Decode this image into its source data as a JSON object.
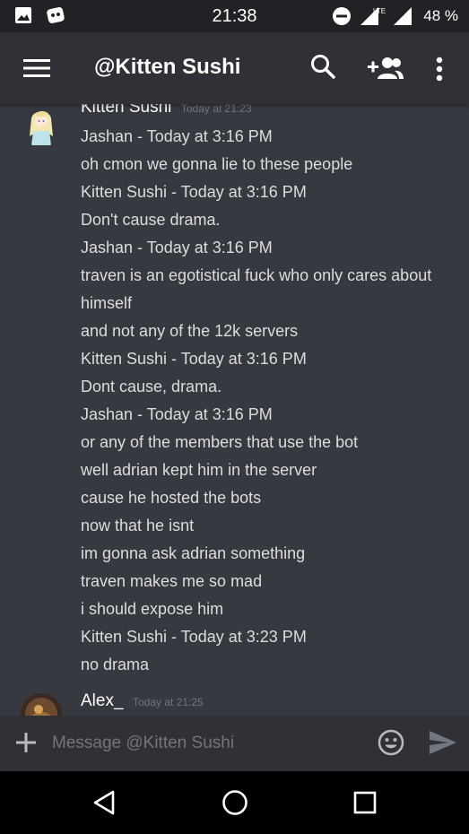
{
  "status_bar": {
    "time": "21:38",
    "network": "LTE",
    "battery": "48 %"
  },
  "header": {
    "title": "@Kitten Sushi",
    "menu_icon": "hamburger-icon",
    "search_icon": "search-icon",
    "add_friend_icon": "add-friend-icon",
    "more_icon": "more-vertical-icon"
  },
  "messages": [
    {
      "author": "Kitten Sushi",
      "timestamp": "Today at 21:23",
      "avatar_icon": "anime-girl-avatar",
      "lines": [
        "Jashan - Today at 3:16 PM",
        "oh cmon we gonna lie to these people",
        "Kitten Sushi - Today at 3:16 PM",
        "Don't cause drama.",
        "Jashan - Today at 3:16 PM",
        "traven is an egotistical fuck who only cares about himself",
        "and not any of the 12k servers",
        "Kitten Sushi - Today at 3:16 PM",
        "Dont cause, drama.",
        "Jashan - Today at 3:16 PM",
        "or any of the members that use the bot",
        "well adrian kept him in the server",
        "cause he hosted the bots",
        "now that he isnt",
        "im gonna ask adrian something",
        "traven makes me so mad",
        "i should expose him",
        "Kitten Sushi - Today at 3:23 PM",
        "no drama"
      ]
    },
    {
      "author": "Alex_",
      "timestamp": "Today at 21:25",
      "avatar_icon": "dark-art-avatar",
      "lines": []
    }
  ],
  "composer": {
    "placeholder": "Message @Kitten Sushi",
    "add_icon": "plus-icon",
    "emoji_icon": "emoji-icon",
    "send_icon": "send-icon"
  },
  "nav_bar": {
    "back_icon": "back-triangle-icon",
    "home_icon": "home-circle-icon",
    "recents_icon": "recents-square-icon"
  }
}
